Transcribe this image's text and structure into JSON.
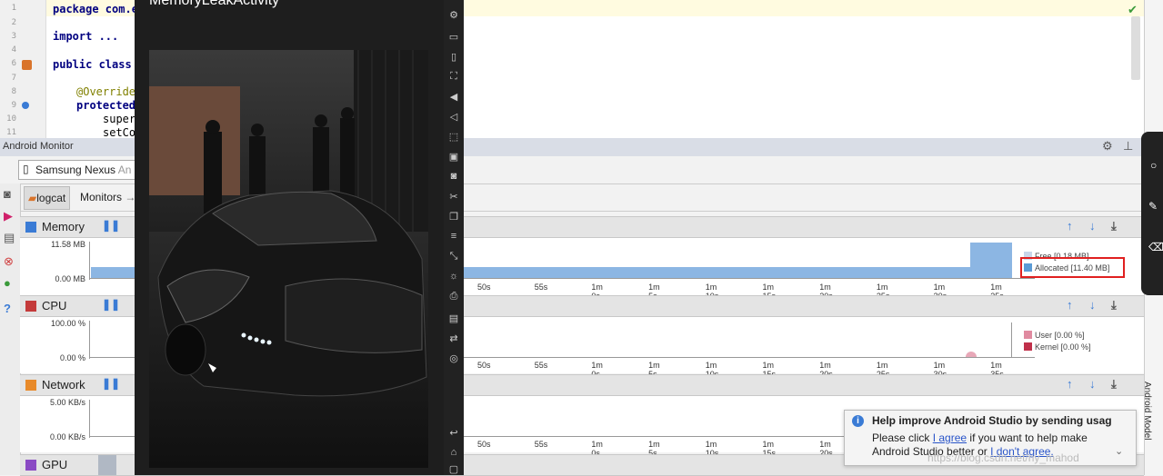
{
  "editor": {
    "line_numbers": [
      "1",
      "2",
      "3",
      "4",
      "5",
      "6",
      "7",
      "8",
      "9",
      "10",
      "11"
    ],
    "lines": {
      "l1": "package com.e",
      "l3": "import ...",
      "l6": "public class",
      "l9": "@Override",
      "l10": "protected",
      "l11a": "super",
      "l11b": "setCo"
    }
  },
  "monitor": {
    "title": "Android Monitor",
    "device": "Samsung Nexus",
    "device_suffix": "An",
    "tabs": {
      "logcat": "logcat",
      "monitors": "Monitors"
    }
  },
  "memory": {
    "name": "Memory",
    "ymax": "11.58 MB",
    "ymin": "0.00 MB",
    "legend_free": "Free [0.18 MB]",
    "legend_allocated": "Allocated [11.40 MB]",
    "allocated_mb": 11.4,
    "free_mb": 0.18
  },
  "cpu": {
    "name": "CPU",
    "ymax": "100.00 %",
    "ymin": "0.00 %",
    "legend_user": "User [0.00 %]",
    "legend_kernel": "Kernel [0.00 %]"
  },
  "network": {
    "name": "Network",
    "ymax": "5.00 KB/s",
    "ymin": "0.00 KB/s"
  },
  "gpu": {
    "name": "GPU"
  },
  "time_ticks": [
    "50s",
    "55s",
    "1m 0s",
    "1m 5s",
    "1m 10s",
    "1m 15s",
    "1m 20s",
    "1m 25s",
    "1m 30s",
    "1m 35s"
  ],
  "time_ticks_net": [
    "50s",
    "55s",
    "1m 0s",
    "1m 5s",
    "1m 10s",
    "1m 15s",
    "1m 20s"
  ],
  "phone": {
    "activity_title": "MemoryLeakActivity"
  },
  "notification": {
    "title": "Help improve Android Studio by sending usag",
    "line1_pre": "Please click ",
    "agree": "I agree",
    "line1_post": " if you want to help make",
    "line2_pre": "Android Studio better or ",
    "disagree": "I don't agree."
  },
  "side": {
    "android_model": "Android Model"
  },
  "watermark": "https://blog.csdn.net/ny_mahod"
}
